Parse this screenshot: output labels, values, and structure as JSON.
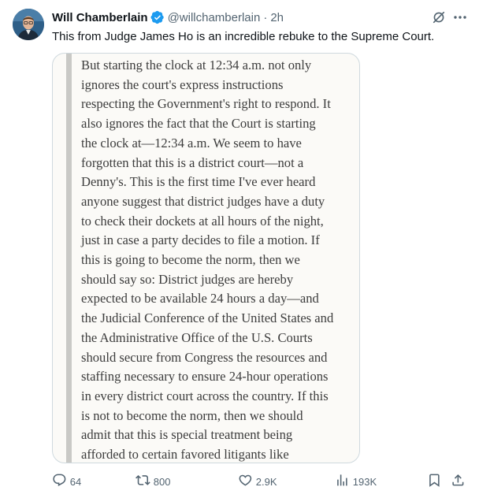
{
  "tweet": {
    "display_name": "Will Chamberlain",
    "handle": "@willchamberlain",
    "separator": "·",
    "time": "2h",
    "text": "This from Judge James Ho is an incredible rebuke to the Supreme Court."
  },
  "media": {
    "lines": [
      "But starting the clock at 12:34 a.m. not only",
      "ignores the court's express instructions",
      "respecting the Government's right to respond. It",
      "also ignores the fact that the Court is starting",
      "the clock at—12:34 a.m. We seem to have",
      "forgotten that this is a district court—not a",
      "Denny's. This is the first time I've ever heard",
      "anyone suggest that district judges have a duty",
      "to check their dockets at all hours of the night,",
      "just in case a party decides to file a motion. If",
      "this is going to become the norm, then we",
      "should say so: District judges are hereby",
      "expected to be available 24 hours a day—and",
      "the Judicial Conference of the United States and",
      "the Administrative Office of the U.S. Courts",
      "should secure from Congress the resources and",
      "staffing necessary to ensure 24-hour operations",
      "in every district court across the country. If this",
      "is not to become the norm, then we should",
      "admit that this is special treatment being",
      "afforded to certain favored litigants like"
    ]
  },
  "actions": {
    "replies": "64",
    "reposts": "800",
    "likes": "2.9K",
    "views": "193K"
  },
  "icons": {
    "verified": "verified-badge-icon",
    "grok": "grok-icon",
    "more": "more-icon",
    "reply": "reply-icon",
    "repost": "repost-icon",
    "like": "like-icon",
    "views": "views-icon",
    "bookmark": "bookmark-icon",
    "share": "share-icon"
  },
  "colors": {
    "verified_blue": "#1d9bf0",
    "secondary_text": "#536471",
    "primary_text": "#0f1419",
    "card_border": "#cfd9de"
  }
}
